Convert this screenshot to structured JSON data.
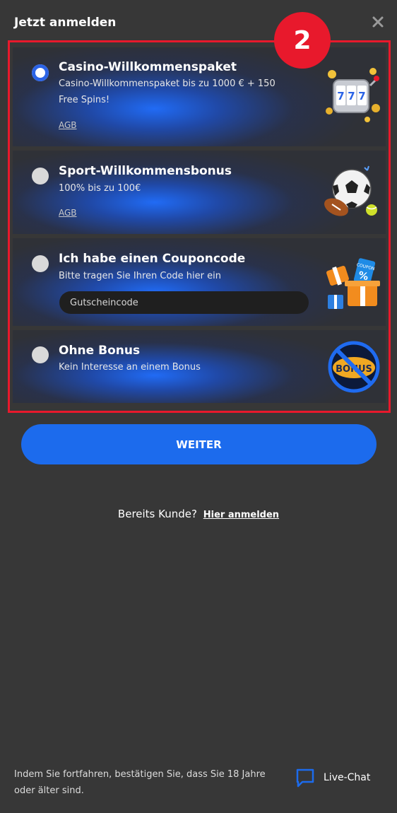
{
  "header": {
    "title": "Jetzt anmelden",
    "close_icon": "close-icon"
  },
  "step_badge": "2",
  "options": [
    {
      "title": "Casino-Willkommenspaket",
      "description": "Casino-Willkommenspaket bis zu 1000 € + 150 Free Spins!",
      "link": "AGB",
      "selected": true,
      "icon": "slot-machine-icon"
    },
    {
      "title": "Sport-Willkommensbonus",
      "description": "100% bis zu 100€",
      "link": "AGB",
      "selected": false,
      "icon": "sports-balls-icon"
    },
    {
      "title": "Ich habe einen Couponcode",
      "description": "Bitte tragen Sie Ihren Code hier ein",
      "input_placeholder": "Gutscheincode",
      "input_value": "",
      "selected": false,
      "icon": "gift-coupon-icon",
      "coupon_tag": "COUPON"
    },
    {
      "title": "Ohne Bonus",
      "description": "Kein Interesse an einem Bonus",
      "selected": false,
      "icon": "no-bonus-icon",
      "icon_text": "BONUS"
    }
  ],
  "actions": {
    "continue_label": "WEITER"
  },
  "login": {
    "prompt": "Bereits Kunde?",
    "link": "Hier anmelden"
  },
  "footer": {
    "note": "Indem Sie fortfahren, bestätigen Sie, dass Sie 18 Jahre oder älter sind.",
    "chat_label": "Live-Chat",
    "chat_icon": "chat-bubble-icon"
  },
  "colors": {
    "background": "#373737",
    "accent_blue": "#1c6bed",
    "highlight_red": "#e8192c",
    "radio_selected": "#2b63e6"
  }
}
